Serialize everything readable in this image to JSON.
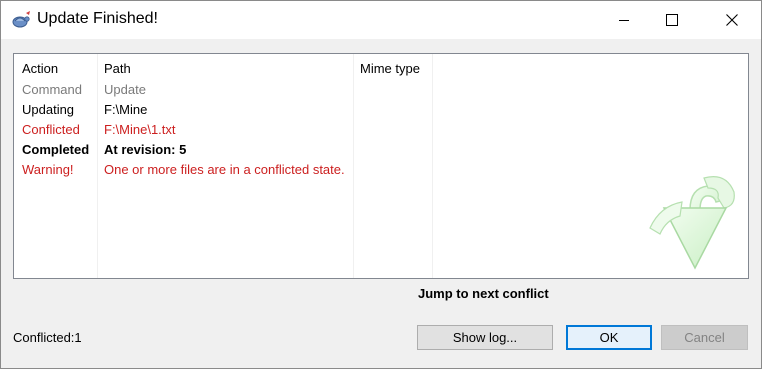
{
  "window": {
    "title": "Update Finished!",
    "icon": "tortoise-app-icon"
  },
  "titlebar_buttons": {
    "minimize": "minimize-icon",
    "maximize": "maximize-icon",
    "close": "close-icon"
  },
  "list": {
    "columns": [
      "Action",
      "Path",
      "Mime type"
    ],
    "rows": [
      {
        "action": "Command",
        "path": "Update",
        "style": "gray"
      },
      {
        "action": "Updating",
        "path": "F:\\Mine",
        "style": "black"
      },
      {
        "action": "Conflicted",
        "path": "F:\\Mine\\1.txt",
        "style": "red"
      },
      {
        "action": "Completed",
        "path": "At revision: 5",
        "style": "bold"
      },
      {
        "action": "Warning!",
        "path": "One or more files are in a conflicted state.",
        "style": "red"
      }
    ],
    "colors": {
      "conflict_red": "#cc1f1f",
      "muted_gray": "#7a7a7a"
    },
    "graphic": "green-curved-arrow-icon"
  },
  "links": {
    "jump_to_next_conflict": "Jump to next conflict"
  },
  "status": {
    "text": "Conflicted:1"
  },
  "buttons": {
    "show_log": "Show log...",
    "ok": "OK",
    "cancel": "Cancel"
  }
}
